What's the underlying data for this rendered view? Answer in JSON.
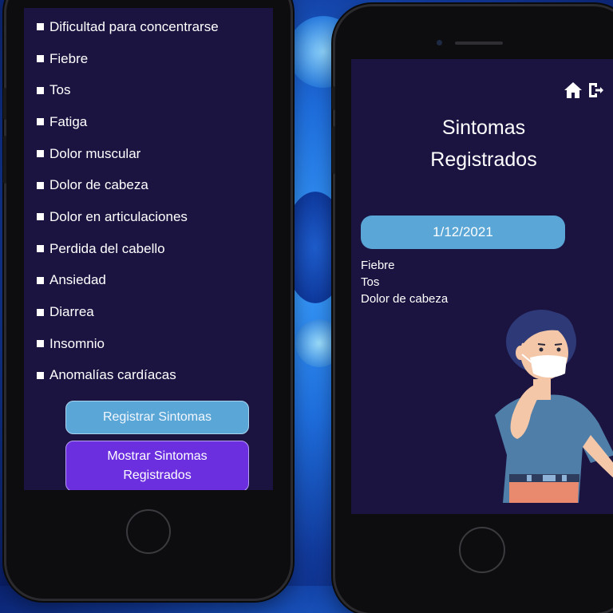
{
  "left_screen": {
    "symptoms": [
      {
        "label": "Dificultad para concentrarse"
      },
      {
        "label": "Fiebre"
      },
      {
        "label": "Tos"
      },
      {
        "label": "Fatiga"
      },
      {
        "label": "Dolor muscular"
      },
      {
        "label": "Dolor de cabeza"
      },
      {
        "label": "Dolor en articulaciones"
      },
      {
        "label": "Perdida del cabello"
      },
      {
        "label": "Ansiedad"
      },
      {
        "label": "Diarrea"
      },
      {
        "label": "Insomnio"
      },
      {
        "label": "Anomalías cardíacas"
      }
    ],
    "register_button": "Registrar Sintomas",
    "show_button": "Mostrar Sintomas\nRegistrados"
  },
  "right_screen": {
    "title": "Sintomas\nRegistrados",
    "date": "1/12/2021",
    "recorded": [
      {
        "label": "Fiebre"
      },
      {
        "label": "Tos"
      },
      {
        "label": "Dolor de cabeza"
      }
    ],
    "icons": {
      "home": "home-icon",
      "logout": "logout-icon"
    }
  },
  "colors": {
    "screen_bg": "#1b1340",
    "register_button": "#5aa6d6",
    "show_button": "#6b2fe0",
    "date_pill": "#5aa6d6"
  }
}
